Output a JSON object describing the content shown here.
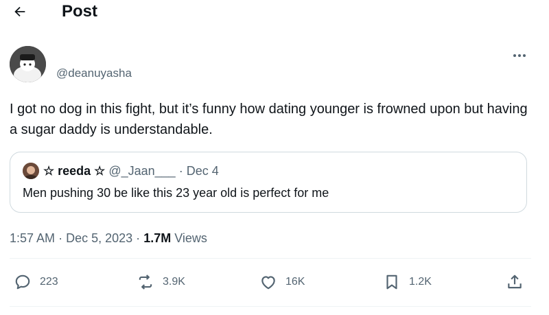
{
  "header": {
    "title": "Post"
  },
  "post": {
    "handle": "@deanuyasha",
    "text": "I got no dog in this fight, but it’s funny how dating younger is frowned upon but having a sugar daddy is understandable.",
    "time": "1:57 AM",
    "date": "Dec 5, 2023",
    "views_count": "1.7M",
    "views_label": "Views"
  },
  "quote": {
    "name": "☆ reeda ☆",
    "handle": "@_Jaan___",
    "date": "Dec 4",
    "text": "Men pushing 30 be like this 23 year old is perfect for me"
  },
  "actions": {
    "replies": "223",
    "reposts": "3.9K",
    "likes": "16K",
    "bookmarks": "1.2K"
  },
  "icons": [
    "back-arrow-icon",
    "more-icon",
    "reply-icon",
    "repost-icon",
    "like-icon",
    "bookmark-icon",
    "share-icon"
  ],
  "colors": {
    "text": "#0f1419",
    "secondary": "#536471",
    "border": "#cfd9de"
  }
}
